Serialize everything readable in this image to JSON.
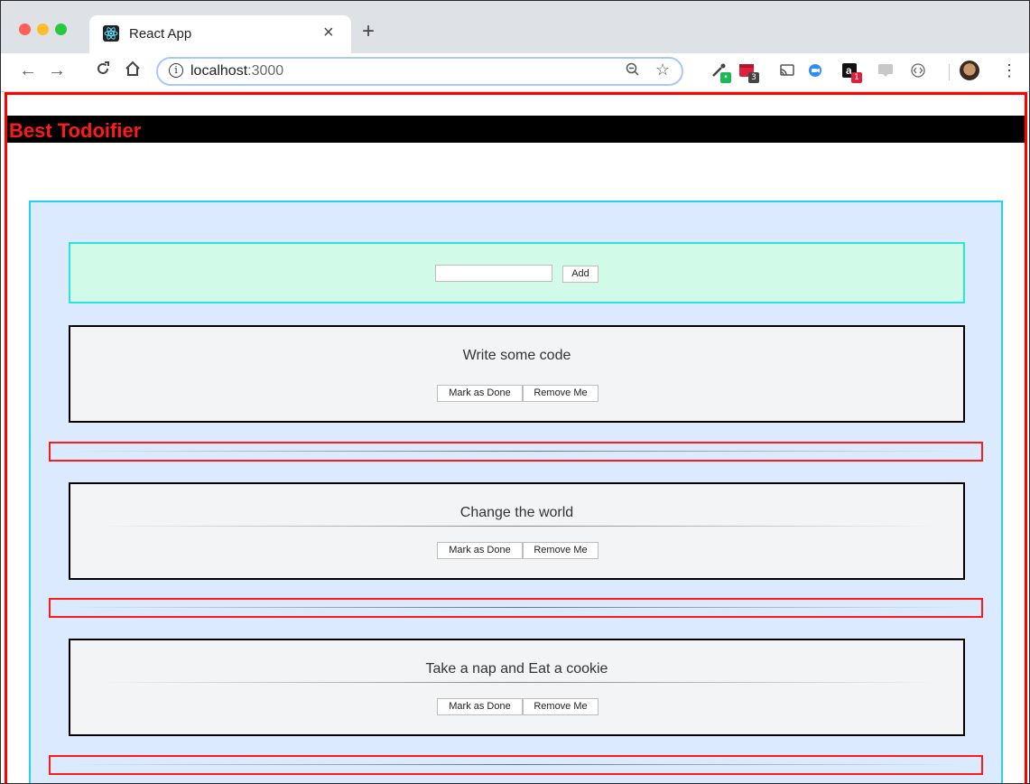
{
  "browser": {
    "tab_title": "React App",
    "close_glyph": "×",
    "new_tab_glyph": "+",
    "url_host": "localhost",
    "url_port": ":3000",
    "info_glyph": "i",
    "extensions": [
      {
        "name": "eyedropper-extension-icon",
        "badge": "",
        "badge_color": "#1db954"
      },
      {
        "name": "red-extension-icon",
        "badge": "3",
        "badge_color": "#444444"
      },
      {
        "name": "cast-icon",
        "badge": ""
      },
      {
        "name": "zoom-extension-icon",
        "badge": ""
      },
      {
        "name": "amazon-extension-icon",
        "badge": "1",
        "badge_color": "#e0203a"
      },
      {
        "name": "css-extension-icon",
        "badge": ""
      },
      {
        "name": "code-extension-icon",
        "badge": ""
      }
    ]
  },
  "app": {
    "title": "Best Todoifier",
    "colors": {
      "header_bg": "#000000",
      "title": "#ff1a1a",
      "app_border": "#ff0000",
      "list_bg": "#dbeafe",
      "list_border": "#22d3ee",
      "add_bg": "#d1fae8",
      "add_border": "#2ae6d6",
      "todo_bg": "#f3f4f6"
    },
    "new_todo": {
      "value": "",
      "add_label": "Add"
    },
    "todos": [
      {
        "text": "Write some code",
        "done_label": "Mark as Done",
        "remove_label": "Remove Me"
      },
      {
        "text": "Change the world",
        "done_label": "Mark as Done",
        "remove_label": "Remove Me"
      },
      {
        "text": "Take a nap and Eat a cookie",
        "done_label": "Mark as Done",
        "remove_label": "Remove Me"
      }
    ]
  }
}
